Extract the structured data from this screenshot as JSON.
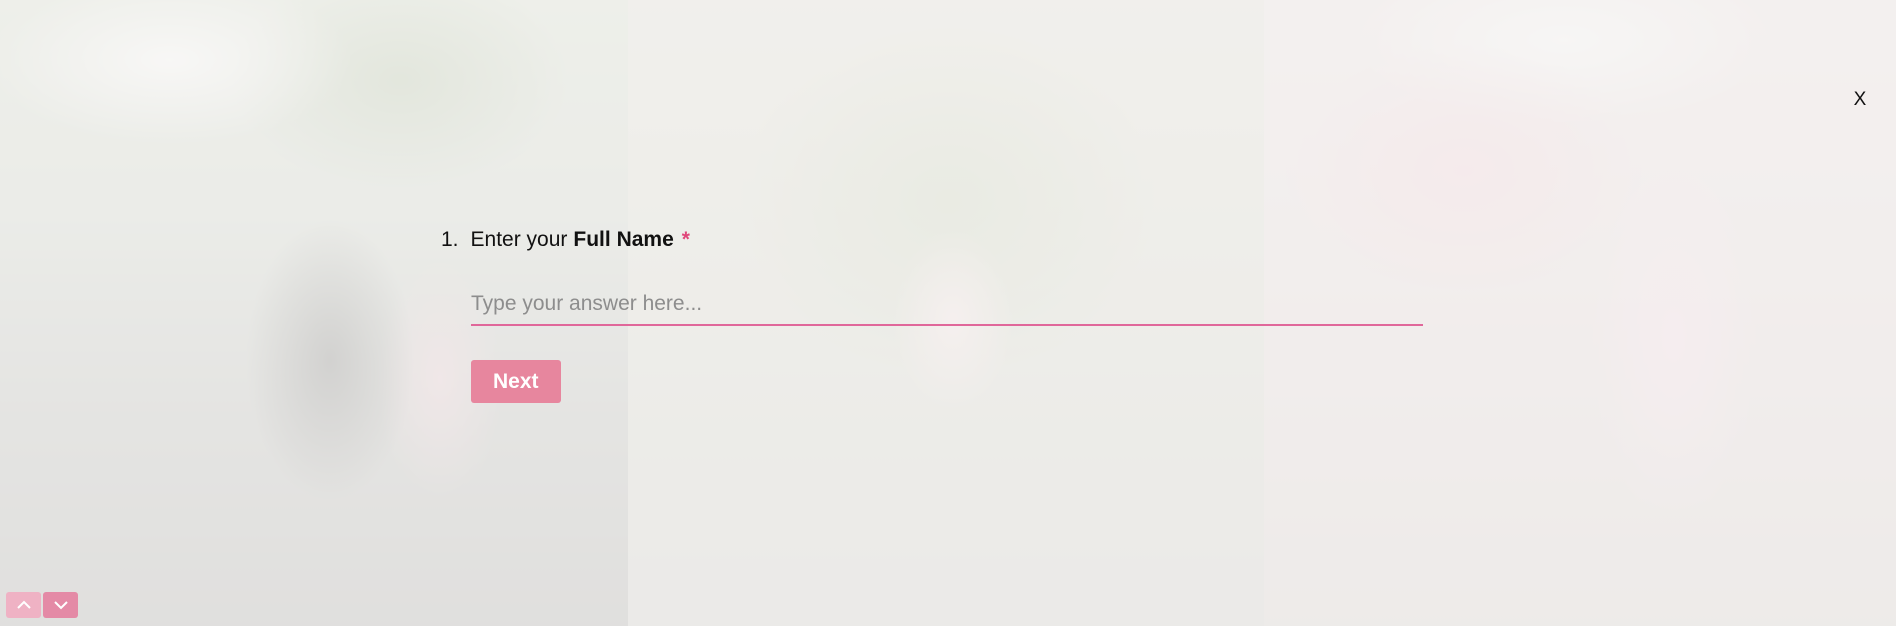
{
  "background": {
    "overlay_color": "#f5f4f2"
  },
  "close": {
    "label": "X"
  },
  "question": {
    "number": "1.",
    "label_prefix": "Enter your",
    "label_strong": "Full Name",
    "required_mark": "*",
    "answer_placeholder": "Type your answer here...",
    "answer_value": ""
  },
  "actions": {
    "next_label": "Next"
  },
  "navigation": {
    "up_icon": "chevron-up-icon",
    "down_icon": "chevron-down-icon"
  },
  "colors": {
    "accent": "#e0679a",
    "button": "#e7869e",
    "required": "#e0467a"
  }
}
